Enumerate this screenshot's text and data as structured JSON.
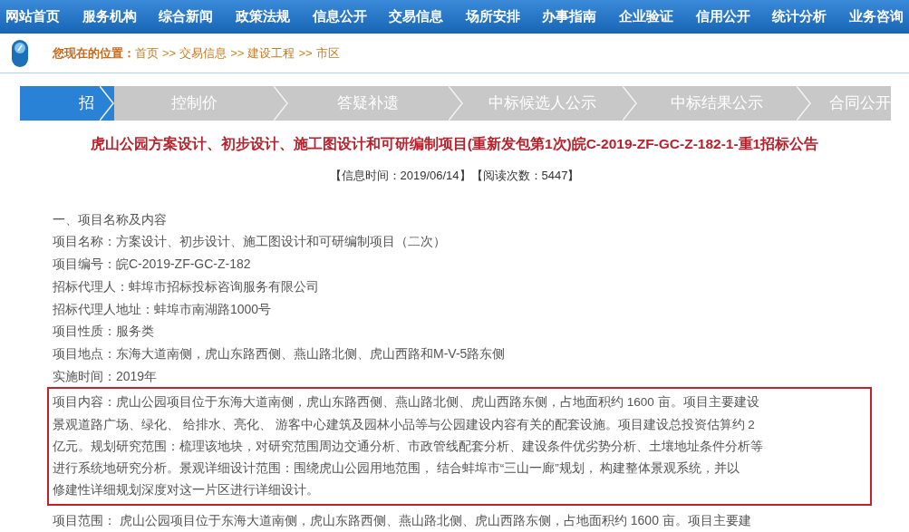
{
  "nav": {
    "items": [
      "网站首页",
      "服务机构",
      "综合新闻",
      "政策法规",
      "信息公开",
      "交易信息",
      "场所安排",
      "办事指南",
      "企业验证",
      "信用公开",
      "统计分析",
      "业务咨询"
    ]
  },
  "breadcrumb": {
    "label": "您现在的位置：",
    "separator": ">>",
    "items": [
      "首页",
      "交易信息",
      "建设工程",
      "市区"
    ]
  },
  "steps": [
    {
      "label": "招",
      "selected": true
    },
    {
      "label": "控制价",
      "selected": false
    },
    {
      "label": "答疑补遗",
      "selected": false
    },
    {
      "label": "中标候选人公示",
      "selected": false
    },
    {
      "label": "中标结果公示",
      "selected": false
    },
    {
      "label": "合同公开",
      "selected": false
    }
  ],
  "article": {
    "title": "虎山公园方案设计、初步设计、施工图设计和可研编制项目(重新发包第1次)皖C-2019-ZF-GC-Z-182-1-重1招标公告",
    "meta": "【信息时间：2019/06/14】【阅读次数：5447】",
    "heading": "一、项目名称及内容",
    "fields": [
      "项目名称：方案设计、初步设计、施工图设计和可研编制项目（二次）",
      "项目编号：皖C-2019-ZF-GC-Z-182",
      "招标代理人：蚌埠市招标投标咨询服务有限公司",
      "招标代理人地址：蚌埠市南湖路1000号",
      "项目性质：服务类",
      "项目地点：东海大道南侧，虎山东路西侧、燕山路北侧、虎山西路和M-V-5路东侧",
      "实施时间：2019年"
    ],
    "highlighted": {
      "lines": [
        "项目内容：虎山公园项目位于东海大道南侧，虎山东路西侧、燕山路北侧、虎山西路东侧，占地面积约 1600 亩。项目主要建设",
        "景观道路广场、绿化、 给排水、亮化、 游客中心建筑及园林小品等与公园建设内容有关的配套设施。项目建设总投资估算约 2",
        "亿元。规划研究范围：梳理该地块，对研究范围周边交通分析、市政管线配套分析、建设条件优劣势分析、土壤地址条件分析等",
        "进行系统地研究分析。景观详细设计范围：围绕虎山公园用地范围， 结合蚌埠市“三山一廊”规划， 构建整体景观系统，并以",
        "修建性详细规划深度对这一片区进行详细设计。"
      ]
    },
    "trailing": "项目范围： 虎山公园项目位于东海大道南侧，虎山东路西侧、燕山路北侧、虎山西路东侧，占地面积约 1600 亩。项目主要建"
  }
}
